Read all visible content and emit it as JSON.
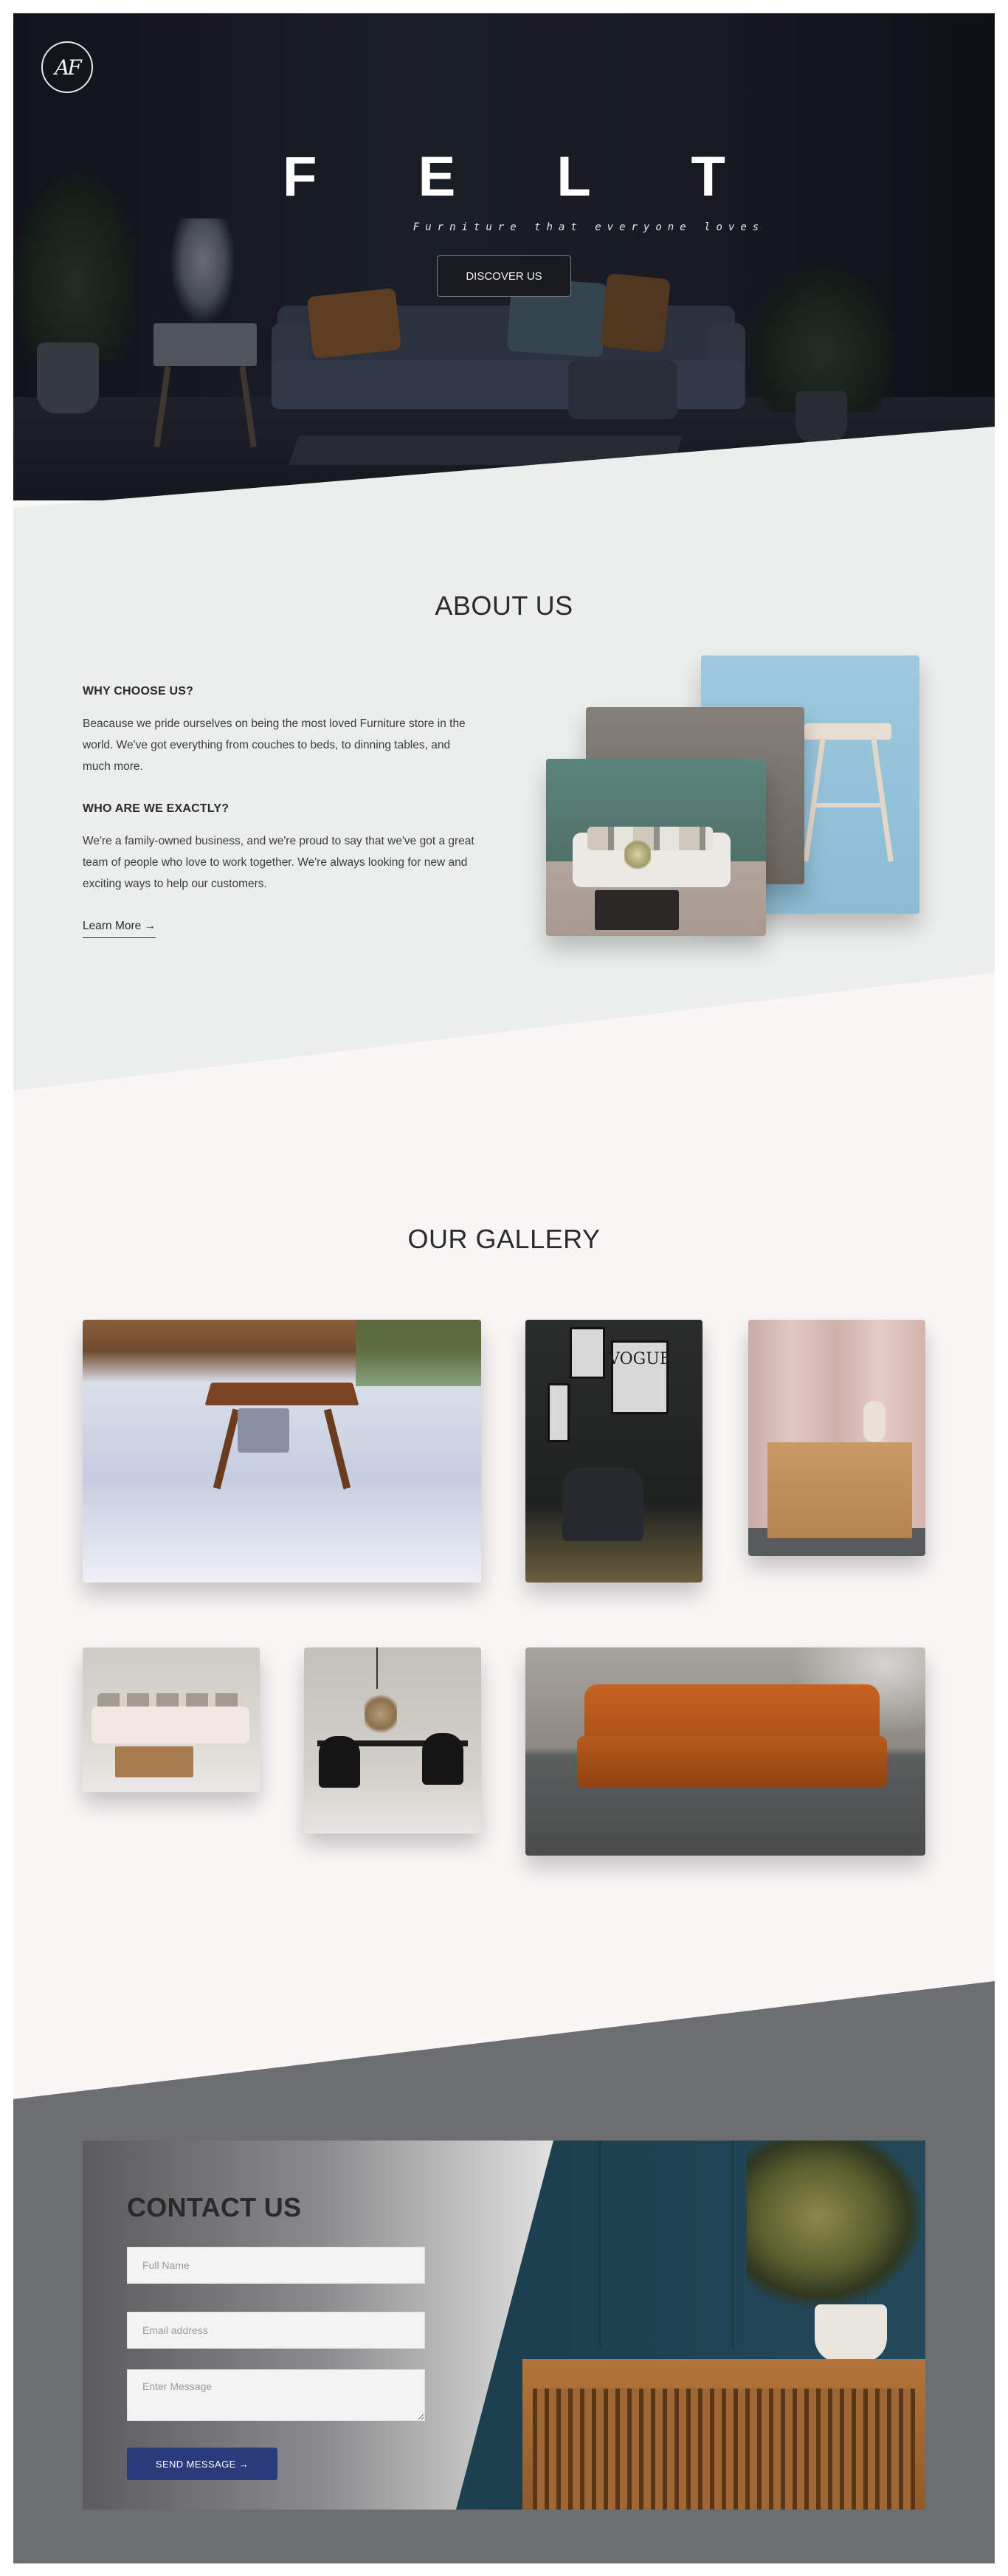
{
  "brand": {
    "logo_text": "AF",
    "title": "F E L T",
    "tagline": "Furniture that everyone loves",
    "cta_label": "DISCOVER US"
  },
  "about": {
    "title": "ABOUT US",
    "blocks": [
      {
        "heading": "WHY CHOOSE US?",
        "body": "Beacause we pride ourselves on being the most loved Furniture store in the world. We've got everything from couches to beds, to dinning tables, and much more."
      },
      {
        "heading": "WHO ARE WE EXACTLY?",
        "body": "We're a family-owned business, and we're proud to say that we've got a great team of people who love to work together. We're always looking for new and exciting ways to help our customers."
      }
    ],
    "learn_more_label": "Learn More →"
  },
  "gallery": {
    "title": "OUR GALLERY",
    "poster_text": "VOGUE"
  },
  "contact": {
    "title": "CONTACT US",
    "name_placeholder": "Full Name",
    "email_placeholder": "Email address",
    "message_placeholder": "Enter Message",
    "send_label": "SEND MESSAGE →"
  },
  "colors": {
    "hero_dark": "#1b1e27",
    "about_bg": "#eceeee",
    "gallery_bg": "#f9f7f6",
    "contact_bg": "#6d6e70",
    "button_blue": "#2b3a7a"
  }
}
